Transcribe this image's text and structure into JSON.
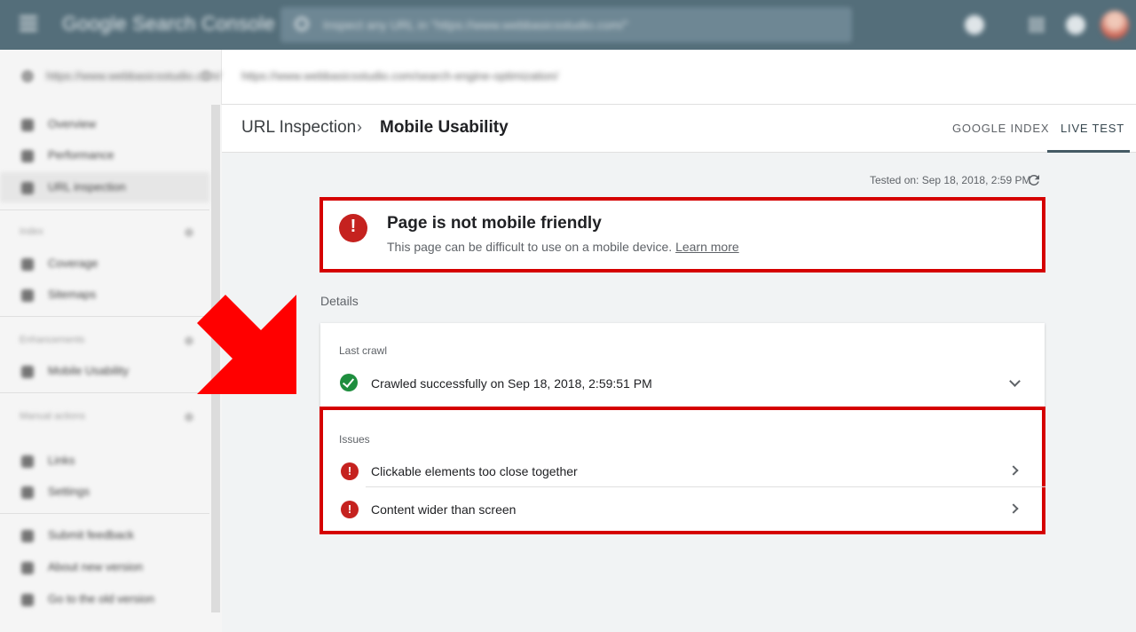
{
  "header_bar": {
    "app_name": "Google Search Console",
    "search_placeholder": "Inspect any URL in \"https://www.webbasicsstudio.com/\""
  },
  "property": {
    "name": "https://www.webbasicsstudio.com/",
    "inspected_url": "https://www.webbasicsstudio.com/search-engine-optimization/"
  },
  "sidebar": {
    "items": [
      {
        "label": "Overview",
        "active": false
      },
      {
        "label": "Performance",
        "active": false
      },
      {
        "label": "URL inspection",
        "active": true
      },
      {
        "label": "Coverage",
        "active": false
      },
      {
        "label": "Sitemaps",
        "active": false
      },
      {
        "label": "Mobile Usability",
        "active": false
      },
      {
        "label": "Links",
        "active": false
      },
      {
        "label": "Settings",
        "active": false
      },
      {
        "label": "Submit feedback",
        "active": false
      },
      {
        "label": "About new version",
        "active": false
      },
      {
        "label": "Go to the old version",
        "active": false
      }
    ],
    "sections": [
      "Index",
      "Enhancements",
      "Manual actions"
    ]
  },
  "page": {
    "breadcrumb_parent": "URL Inspection",
    "breadcrumb_current": "Mobile Usability",
    "tabs": [
      {
        "label": "GOOGLE INDEX",
        "active": false
      },
      {
        "label": "LIVE TEST",
        "active": true
      }
    ],
    "tested_on": "Tested on: Sep 18, 2018, 2:59 PM"
  },
  "status": {
    "title": "Page is not mobile friendly",
    "description": "This page can be difficult to use on a mobile device.",
    "learn_more": "Learn more"
  },
  "details": {
    "heading": "Details",
    "last_crawl_label": "Last crawl",
    "last_crawl_text": "Crawled successfully on Sep 18, 2018, 2:59:51 PM",
    "issues_label": "Issues",
    "issues": [
      "Clickable elements too close together",
      "Content wider than screen"
    ]
  },
  "colors": {
    "appbar": "#546e7a",
    "error_red": "#c5221f",
    "success_green": "#1e8e3e",
    "annotation_red": "#d50000"
  }
}
